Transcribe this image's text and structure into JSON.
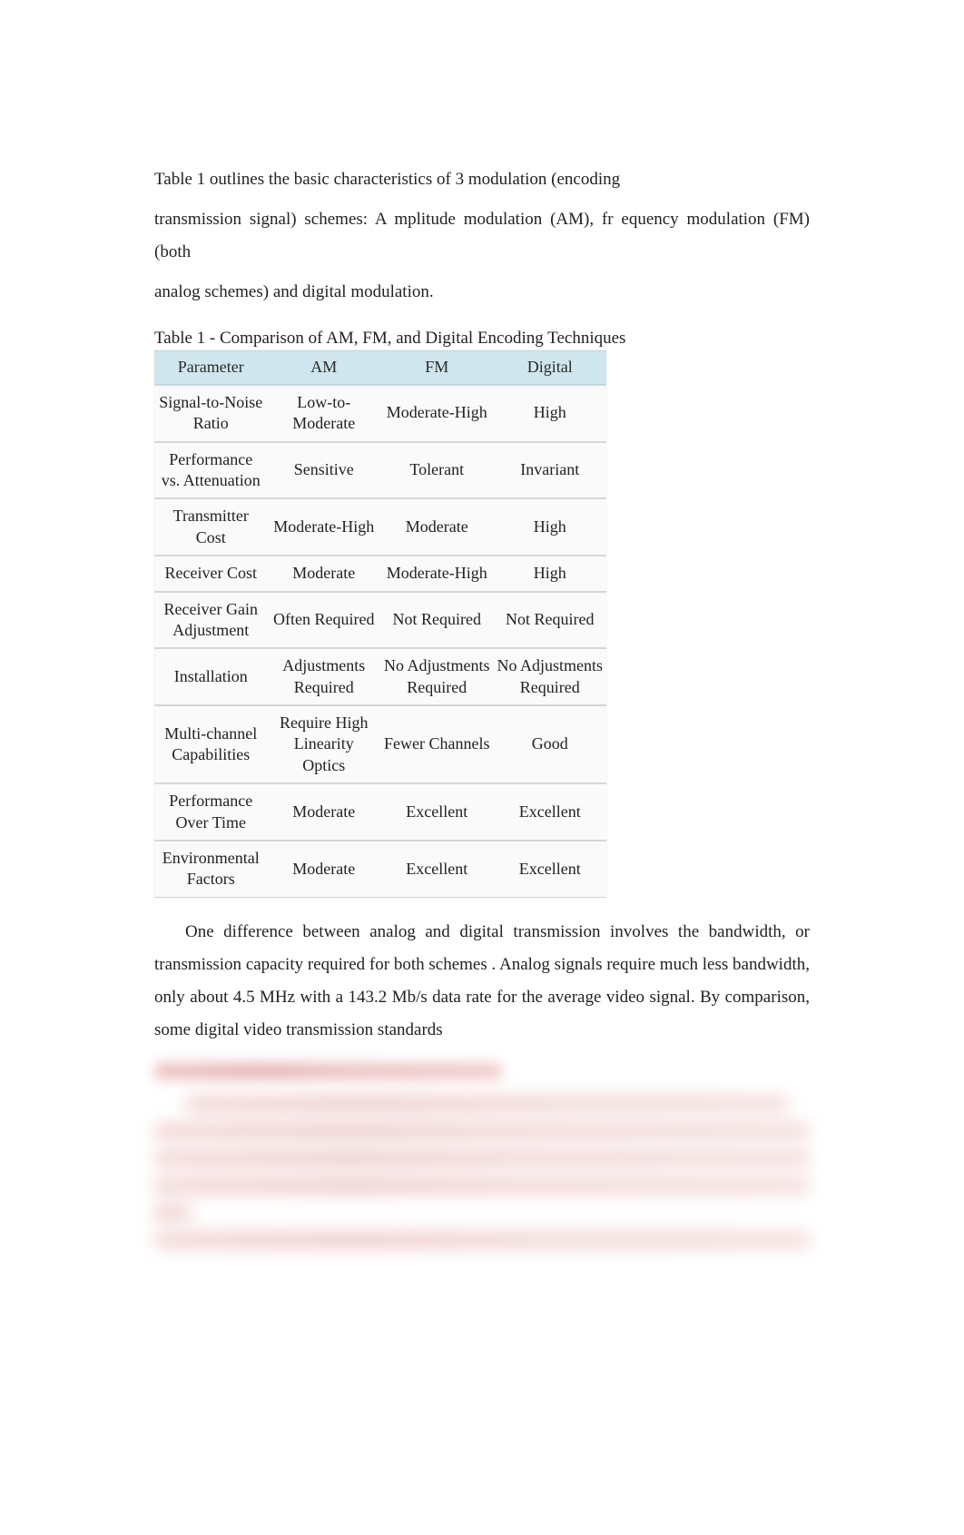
{
  "intro": {
    "p1_part1": "Table  1 outlines the basic characteristics of 3 modulation (encoding",
    "p1_part2": "transmission signal) schemes: A  mplitude  modulation  (AM), fr equency  modulation (FM)  (both",
    "p1_part3": "analog schemes) and digital modulation."
  },
  "table": {
    "caption": "Table 1 - Comparison of AM, FM, and Digital Encoding Techniques",
    "headers": [
      "Parameter",
      "AM",
      "FM",
      "Digital"
    ],
    "rows": [
      [
        "Signal-to-Noise Ratio",
        "Low-to-Moderate",
        "Moderate-High",
        "High"
      ],
      [
        "Performance vs. Attenuation",
        "Sensitive",
        "Tolerant",
        "Invariant"
      ],
      [
        "Transmitter Cost",
        "Moderate-High",
        "Moderate",
        "High"
      ],
      [
        "Receiver Cost",
        "Moderate",
        "Moderate-High",
        "High"
      ],
      [
        "Receiver Gain Adjustment",
        "Often Required",
        "Not Required",
        "Not Required"
      ],
      [
        "Installation",
        "Adjustments Required",
        "No Adjustments Required",
        "No Adjustments Required"
      ],
      [
        "Multi-channel Capabilities",
        "Require High Linearity Optics",
        "Fewer Channels",
        "Good"
      ],
      [
        "Performance Over Time",
        "Moderate",
        "Excellent",
        "Excellent"
      ],
      [
        "Environmental Factors",
        "Moderate",
        "Excellent",
        "Excellent"
      ]
    ]
  },
  "body": {
    "p2": "One  difference  between  analog  and  digital  transmission  involves      the bandwidth, or transmission capacity      required for both schemes  . Analog signals require much less bandwidth, only about 4.5 MHz with a 143.2 Mb/s data rate for the average video signal. By    comparison, some digital video transmission     standards"
  },
  "chart_data": {
    "type": "table",
    "title": "Table 1 - Comparison of AM, FM, and Digital Encoding Techniques",
    "columns": [
      "Parameter",
      "AM",
      "FM",
      "Digital"
    ],
    "rows": [
      [
        "Signal-to-Noise Ratio",
        "Low-to-Moderate",
        "Moderate-High",
        "High"
      ],
      [
        "Performance vs. Attenuation",
        "Sensitive",
        "Tolerant",
        "Invariant"
      ],
      [
        "Transmitter Cost",
        "Moderate-High",
        "Moderate",
        "High"
      ],
      [
        "Receiver Cost",
        "Moderate",
        "Moderate-High",
        "High"
      ],
      [
        "Receiver Gain Adjustment",
        "Often Required",
        "Not Required",
        "Not Required"
      ],
      [
        "Installation",
        "Adjustments Required",
        "No Adjustments Required",
        "No Adjustments Required"
      ],
      [
        "Multi-channel Capabilities",
        "Require High Linearity Optics",
        "Fewer Channels",
        "Good"
      ],
      [
        "Performance Over Time",
        "Moderate",
        "Excellent",
        "Excellent"
      ],
      [
        "Environmental Factors",
        "Moderate",
        "Excellent",
        "Excellent"
      ]
    ]
  }
}
